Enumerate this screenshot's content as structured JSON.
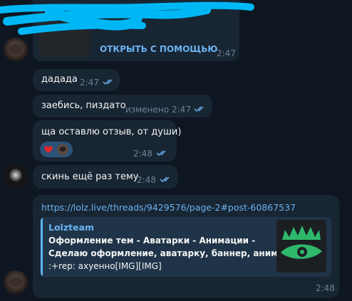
{
  "top_message": {
    "action_label": "ОТКРЫТЬ С ПОМОЩЬЮ",
    "time": "2:47"
  },
  "messages": [
    {
      "text": "дадада",
      "time": "2:47",
      "edited": ""
    },
    {
      "text": "заебись, пиздато",
      "time": "2:47",
      "edited": "изменено"
    },
    {
      "text": "ща оставлю отзыв, от души)",
      "time": "2:48",
      "edited": ""
    },
    {
      "text": "скинь ещё раз тему",
      "time": "2:48",
      "edited": ""
    }
  ],
  "reactions": [
    "heart-reaction",
    "avatar-reaction"
  ],
  "link_message": {
    "url": "https://lolz.live/threads/9429576/page-2#post-60867537",
    "preview": {
      "site": "Lolzteam",
      "title_line1": "Оформление тем - Аватарки - Анимации -",
      "title_line2": "Сделаю оформление, аватарку, баннер, аним...",
      "description": ":+rep: ахуенно[IMG][IMG]"
    },
    "time": "2:48"
  },
  "colors": {
    "background": "#0e1621",
    "bubble": "#182533",
    "accent": "#6ab3f3",
    "time": "#6d8097",
    "preview_bar": "#5eb5f7",
    "logo_green": "#2fb86b"
  }
}
